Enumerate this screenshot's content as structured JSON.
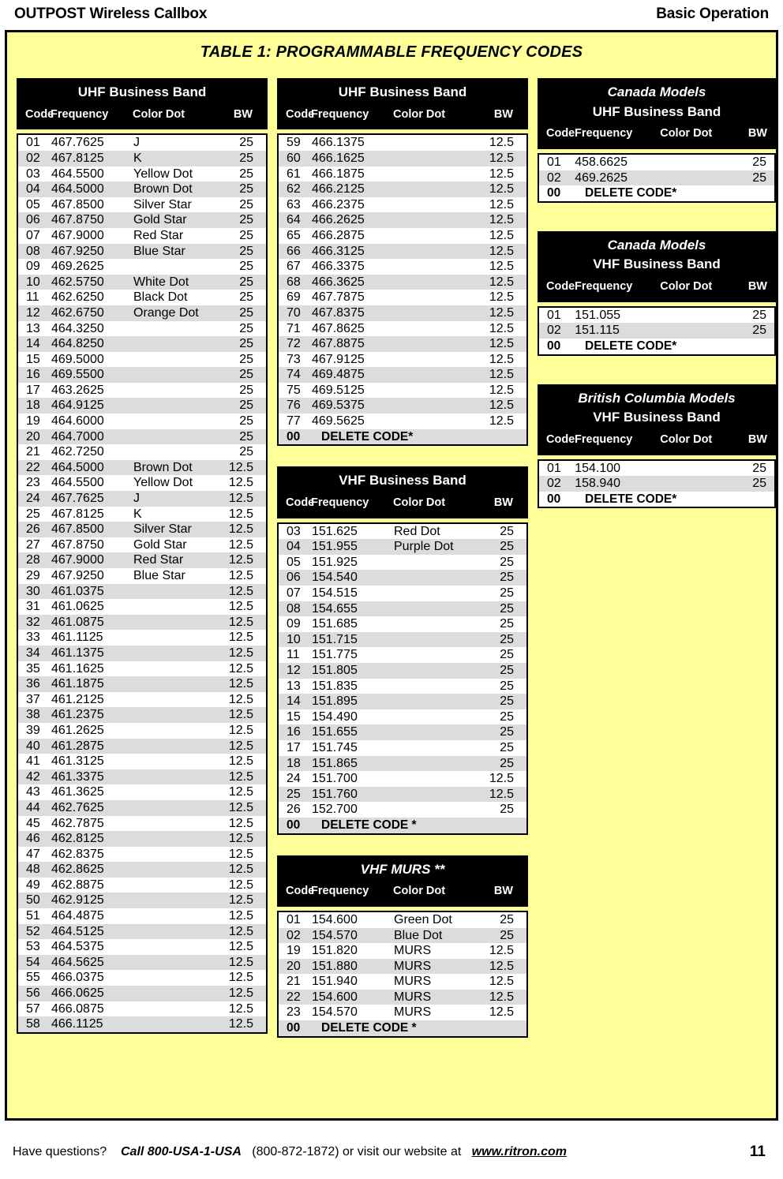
{
  "colors": {
    "panel_background": "#ffff99",
    "header_background": "#000000",
    "header_text": "#ffffff",
    "row_shade": "#dcdcdc",
    "page_background": "#ffffff"
  },
  "running_head": {
    "left": "OUTPOST Wireless Callbox",
    "right": "Basic Operation"
  },
  "panel": {
    "title": "TABLE 1: PROGRAMMABLE FREQUENCY CODES"
  },
  "column_headers": {
    "code": "Code",
    "frequency": "Frequency",
    "color_dot": "Color Dot",
    "bw": "BW"
  },
  "tables": [
    {
      "id": "uhf-business-band-1",
      "column": 1,
      "title_lines": [
        "UHF Business Band"
      ],
      "italic_first_line": false,
      "rows": [
        {
          "code": "01",
          "frequency": "467.7625",
          "color_dot": "J",
          "bw": "25",
          "shade": false
        },
        {
          "code": "02",
          "frequency": "467.8125",
          "color_dot": "K",
          "bw": "25",
          "shade": true
        },
        {
          "code": "03",
          "frequency": "464.5500",
          "color_dot": "Yellow Dot",
          "bw": "25",
          "shade": false
        },
        {
          "code": "04",
          "frequency": "464.5000",
          "color_dot": "Brown Dot",
          "bw": "25",
          "shade": true
        },
        {
          "code": "05",
          "frequency": "467.8500",
          "color_dot": "Silver Star",
          "bw": "25",
          "shade": false
        },
        {
          "code": "06",
          "frequency": "467.8750",
          "color_dot": "Gold Star",
          "bw": "25",
          "shade": true
        },
        {
          "code": "07",
          "frequency": "467.9000",
          "color_dot": "Red Star",
          "bw": "25",
          "shade": false
        },
        {
          "code": "08",
          "frequency": "467.9250",
          "color_dot": "Blue Star",
          "bw": "25",
          "shade": true
        },
        {
          "code": "09",
          "frequency": "469.2625",
          "color_dot": "",
          "bw": "25",
          "shade": false
        },
        {
          "code": "10",
          "frequency": "462.5750",
          "color_dot": "White Dot",
          "bw": "25",
          "shade": true
        },
        {
          "code": "11",
          "frequency": "462.6250",
          "color_dot": "Black Dot",
          "bw": "25",
          "shade": false
        },
        {
          "code": "12",
          "frequency": "462.6750",
          "color_dot": "Orange Dot",
          "bw": "25",
          "shade": true
        },
        {
          "code": "13",
          "frequency": "464.3250",
          "color_dot": "",
          "bw": "25",
          "shade": false
        },
        {
          "code": "14",
          "frequency": "464.8250",
          "color_dot": "",
          "bw": "25",
          "shade": true
        },
        {
          "code": "15",
          "frequency": "469.5000",
          "color_dot": "",
          "bw": "25",
          "shade": false
        },
        {
          "code": "16",
          "frequency": "469.5500",
          "color_dot": "",
          "bw": "25",
          "shade": true
        },
        {
          "code": "17",
          "frequency": "463.2625",
          "color_dot": "",
          "bw": "25",
          "shade": false
        },
        {
          "code": "18",
          "frequency": "464.9125",
          "color_dot": "",
          "bw": "25",
          "shade": true
        },
        {
          "code": "19",
          "frequency": "464.6000",
          "color_dot": "",
          "bw": "25",
          "shade": false
        },
        {
          "code": "20",
          "frequency": "464.7000",
          "color_dot": "",
          "bw": "25",
          "shade": true
        },
        {
          "code": "21",
          "frequency": "462.7250",
          "color_dot": "",
          "bw": "25",
          "shade": false
        },
        {
          "code": "22",
          "frequency": "464.5000",
          "color_dot": "Brown Dot",
          "bw": "12.5",
          "shade": true
        },
        {
          "code": "23",
          "frequency": "464.5500",
          "color_dot": "Yellow Dot",
          "bw": "12.5",
          "shade": false
        },
        {
          "code": "24",
          "frequency": "467.7625",
          "color_dot": "J",
          "bw": "12.5",
          "shade": true
        },
        {
          "code": "25",
          "frequency": "467.8125",
          "color_dot": "K",
          "bw": "12.5",
          "shade": false
        },
        {
          "code": "26",
          "frequency": "467.8500",
          "color_dot": "Silver Star",
          "bw": "12.5",
          "shade": true
        },
        {
          "code": "27",
          "frequency": "467.8750",
          "color_dot": "Gold Star",
          "bw": "12.5",
          "shade": false
        },
        {
          "code": "28",
          "frequency": "467.9000",
          "color_dot": "Red Star",
          "bw": "12.5",
          "shade": true
        },
        {
          "code": "29",
          "frequency": "467.9250",
          "color_dot": "Blue Star",
          "bw": "12.5",
          "shade": false
        },
        {
          "code": "30",
          "frequency": "461.0375",
          "color_dot": "",
          "bw": "12.5",
          "shade": true
        },
        {
          "code": "31",
          "frequency": "461.0625",
          "color_dot": "",
          "bw": "12.5",
          "shade": false
        },
        {
          "code": "32",
          "frequency": "461.0875",
          "color_dot": "",
          "bw": "12.5",
          "shade": true
        },
        {
          "code": "33",
          "frequency": "461.1125",
          "color_dot": "",
          "bw": "12.5",
          "shade": false
        },
        {
          "code": "34",
          "frequency": "461.1375",
          "color_dot": "",
          "bw": "12.5",
          "shade": true
        },
        {
          "code": "35",
          "frequency": "461.1625",
          "color_dot": "",
          "bw": "12.5",
          "shade": false
        },
        {
          "code": "36",
          "frequency": "461.1875",
          "color_dot": "",
          "bw": "12.5",
          "shade": true
        },
        {
          "code": "37",
          "frequency": "461.2125",
          "color_dot": "",
          "bw": "12.5",
          "shade": false
        },
        {
          "code": "38",
          "frequency": "461.2375",
          "color_dot": "",
          "bw": "12.5",
          "shade": true
        },
        {
          "code": "39",
          "frequency": "461.2625",
          "color_dot": "",
          "bw": "12.5",
          "shade": false
        },
        {
          "code": "40",
          "frequency": "461.2875",
          "color_dot": "",
          "bw": "12.5",
          "shade": true
        },
        {
          "code": "41",
          "frequency": "461.3125",
          "color_dot": "",
          "bw": "12.5",
          "shade": false
        },
        {
          "code": "42",
          "frequency": "461.3375",
          "color_dot": "",
          "bw": "12.5",
          "shade": true
        },
        {
          "code": "43",
          "frequency": "461.3625",
          "color_dot": "",
          "bw": "12.5",
          "shade": false
        },
        {
          "code": "44",
          "frequency": "462.7625",
          "color_dot": "",
          "bw": "12.5",
          "shade": true
        },
        {
          "code": "45",
          "frequency": "462.7875",
          "color_dot": "",
          "bw": "12.5",
          "shade": false
        },
        {
          "code": "46",
          "frequency": "462.8125",
          "color_dot": "",
          "bw": "12.5",
          "shade": true
        },
        {
          "code": "47",
          "frequency": "462.8375",
          "color_dot": "",
          "bw": "12.5",
          "shade": false
        },
        {
          "code": "48",
          "frequency": "462.8625",
          "color_dot": "",
          "bw": "12.5",
          "shade": true
        },
        {
          "code": "49",
          "frequency": "462.8875",
          "color_dot": "",
          "bw": "12.5",
          "shade": false
        },
        {
          "code": "50",
          "frequency": "462.9125",
          "color_dot": "",
          "bw": "12.5",
          "shade": true
        },
        {
          "code": "51",
          "frequency": "464.4875",
          "color_dot": "",
          "bw": "12.5",
          "shade": false
        },
        {
          "code": "52",
          "frequency": "464.5125",
          "color_dot": "",
          "bw": "12.5",
          "shade": true
        },
        {
          "code": "53",
          "frequency": "464.5375",
          "color_dot": "",
          "bw": "12.5",
          "shade": false
        },
        {
          "code": "54",
          "frequency": "464.5625",
          "color_dot": "",
          "bw": "12.5",
          "shade": true
        },
        {
          "code": "55",
          "frequency": "466.0375",
          "color_dot": "",
          "bw": "12.5",
          "shade": false
        },
        {
          "code": "56",
          "frequency": "466.0625",
          "color_dot": "",
          "bw": "12.5",
          "shade": true
        },
        {
          "code": "57",
          "frequency": "466.0875",
          "color_dot": "",
          "bw": "12.5",
          "shade": false
        },
        {
          "code": "58",
          "frequency": "466.1125",
          "color_dot": "",
          "bw": "12.5",
          "shade": true
        }
      ]
    },
    {
      "id": "uhf-business-band-2",
      "column": 2,
      "title_lines": [
        "UHF Business Band"
      ],
      "italic_first_line": false,
      "rows": [
        {
          "code": "59",
          "frequency": "466.1375",
          "color_dot": "",
          "bw": "12.5",
          "shade": false
        },
        {
          "code": "60",
          "frequency": "466.1625",
          "color_dot": "",
          "bw": "12.5",
          "shade": true
        },
        {
          "code": "61",
          "frequency": "466.1875",
          "color_dot": "",
          "bw": "12.5",
          "shade": false
        },
        {
          "code": "62",
          "frequency": "466.2125",
          "color_dot": "",
          "bw": "12.5",
          "shade": true
        },
        {
          "code": "63",
          "frequency": "466.2375",
          "color_dot": "",
          "bw": "12.5",
          "shade": false
        },
        {
          "code": "64",
          "frequency": "466.2625",
          "color_dot": "",
          "bw": "12.5",
          "shade": true
        },
        {
          "code": "65",
          "frequency": "466.2875",
          "color_dot": "",
          "bw": "12.5",
          "shade": false
        },
        {
          "code": "66",
          "frequency": "466.3125",
          "color_dot": "",
          "bw": "12.5",
          "shade": true
        },
        {
          "code": "67",
          "frequency": "466.3375",
          "color_dot": "",
          "bw": "12.5",
          "shade": false
        },
        {
          "code": "68",
          "frequency": "466.3625",
          "color_dot": "",
          "bw": "12.5",
          "shade": true
        },
        {
          "code": "69",
          "frequency": "467.7875",
          "color_dot": "",
          "bw": "12.5",
          "shade": false
        },
        {
          "code": "70",
          "frequency": "467.8375",
          "color_dot": "",
          "bw": "12.5",
          "shade": true
        },
        {
          "code": "71",
          "frequency": "467.8625",
          "color_dot": "",
          "bw": "12.5",
          "shade": false
        },
        {
          "code": "72",
          "frequency": "467.8875",
          "color_dot": "",
          "bw": "12.5",
          "shade": true
        },
        {
          "code": "73",
          "frequency": "467.9125",
          "color_dot": "",
          "bw": "12.5",
          "shade": false
        },
        {
          "code": "74",
          "frequency": "469.4875",
          "color_dot": "",
          "bw": "12.5",
          "shade": true
        },
        {
          "code": "75",
          "frequency": "469.5125",
          "color_dot": "",
          "bw": "12.5",
          "shade": false
        },
        {
          "code": "76",
          "frequency": "469.5375",
          "color_dot": "",
          "bw": "12.5",
          "shade": true
        },
        {
          "code": "77",
          "frequency": "469.5625",
          "color_dot": "",
          "bw": "12.5",
          "shade": false
        },
        {
          "code": "00",
          "delete_label": "DELETE CODE*",
          "shade": true,
          "is_delete": true
        }
      ]
    },
    {
      "id": "vhf-business-band",
      "column": 2,
      "title_lines": [
        "VHF Business Band"
      ],
      "italic_first_line": false,
      "rows": [
        {
          "code": "03",
          "frequency": "151.625",
          "color_dot": "Red Dot",
          "bw": "25",
          "shade": false
        },
        {
          "code": "04",
          "frequency": "151.955",
          "color_dot": "Purple Dot",
          "bw": "25",
          "shade": true
        },
        {
          "code": "05",
          "frequency": "151.925",
          "color_dot": "",
          "bw": "25",
          "shade": false
        },
        {
          "code": "06",
          "frequency": "154.540",
          "color_dot": "",
          "bw": "25",
          "shade": true
        },
        {
          "code": "07",
          "frequency": "154.515",
          "color_dot": "",
          "bw": "25",
          "shade": false
        },
        {
          "code": "08",
          "frequency": "154.655",
          "color_dot": "",
          "bw": "25",
          "shade": true
        },
        {
          "code": "09",
          "frequency": "151.685",
          "color_dot": "",
          "bw": "25",
          "shade": false
        },
        {
          "code": "10",
          "frequency": "151.715",
          "color_dot": "",
          "bw": "25",
          "shade": true
        },
        {
          "code": "11",
          "frequency": "151.775",
          "color_dot": "",
          "bw": "25",
          "shade": false
        },
        {
          "code": "12",
          "frequency": "151.805",
          "color_dot": "",
          "bw": "25",
          "shade": true
        },
        {
          "code": "13",
          "frequency": "151.835",
          "color_dot": "",
          "bw": "25",
          "shade": false
        },
        {
          "code": "14",
          "frequency": "151.895",
          "color_dot": "",
          "bw": "25",
          "shade": true
        },
        {
          "code": "15",
          "frequency": "154.490",
          "color_dot": "",
          "bw": "25",
          "shade": false
        },
        {
          "code": "16",
          "frequency": "151.655",
          "color_dot": "",
          "bw": "25",
          "shade": true
        },
        {
          "code": "17",
          "frequency": "151.745",
          "color_dot": "",
          "bw": "25",
          "shade": false
        },
        {
          "code": "18",
          "frequency": "151.865",
          "color_dot": "",
          "bw": "25",
          "shade": true
        },
        {
          "code": "24",
          "frequency": "151.700",
          "color_dot": "",
          "bw": "12.5",
          "shade": false
        },
        {
          "code": "25",
          "frequency": "151.760",
          "color_dot": "",
          "bw": "12.5",
          "shade": true
        },
        {
          "code": "26",
          "frequency": "152.700",
          "color_dot": "",
          "bw": "25",
          "shade": false
        },
        {
          "code": "00",
          "delete_label": "DELETE CODE *",
          "shade": true,
          "is_delete": true
        }
      ]
    },
    {
      "id": "vhf-murs",
      "column": 2,
      "title_lines": [
        "VHF MURS **"
      ],
      "italic_first_line": true,
      "rows": [
        {
          "code": "01",
          "frequency": "154.600",
          "color_dot": "Green Dot",
          "bw": "25",
          "shade": false
        },
        {
          "code": "02",
          "frequency": "154.570",
          "color_dot": "Blue Dot",
          "bw": "25",
          "shade": true
        },
        {
          "code": "19",
          "frequency": "151.820",
          "color_dot": "MURS",
          "bw": "12.5",
          "shade": false
        },
        {
          "code": "20",
          "frequency": "151.880",
          "color_dot": "MURS",
          "bw": "12.5",
          "shade": true
        },
        {
          "code": "21",
          "frequency": "151.940",
          "color_dot": "MURS",
          "bw": "12.5",
          "shade": false
        },
        {
          "code": "22",
          "frequency": "154.600",
          "color_dot": "MURS",
          "bw": "12.5",
          "shade": true
        },
        {
          "code": "23",
          "frequency": "154.570",
          "color_dot": "MURS",
          "bw": "12.5",
          "shade": false
        },
        {
          "code": "00",
          "delete_label": "DELETE CODE *",
          "shade": true,
          "is_delete": true
        }
      ]
    },
    {
      "id": "canada-uhf",
      "column": 3,
      "title_lines": [
        "Canada Models",
        "UHF Business Band"
      ],
      "italic_first_line": true,
      "rows": [
        {
          "code": "01",
          "frequency": "458.6625",
          "color_dot": "",
          "bw": "25",
          "shade": false
        },
        {
          "code": "02",
          "frequency": "469.2625",
          "color_dot": "",
          "bw": "25",
          "shade": true
        },
        {
          "code": "00",
          "delete_label": "DELETE CODE*",
          "shade": false,
          "is_delete": true
        }
      ]
    },
    {
      "id": "canada-vhf",
      "column": 3,
      "title_lines": [
        "Canada Models",
        "VHF Business Band"
      ],
      "italic_first_line": true,
      "rows": [
        {
          "code": "01",
          "frequency": "151.055",
          "color_dot": "",
          "bw": "25",
          "shade": false
        },
        {
          "code": "02",
          "frequency": "151.115",
          "color_dot": "",
          "bw": "25",
          "shade": true
        },
        {
          "code": "00",
          "delete_label": "DELETE CODE*",
          "shade": false,
          "is_delete": true
        }
      ]
    },
    {
      "id": "british-columbia-vhf",
      "column": 3,
      "title_lines": [
        "British Columbia  Models",
        "VHF Business Band"
      ],
      "italic_first_line": true,
      "rows": [
        {
          "code": "01",
          "frequency": "154.100",
          "color_dot": "",
          "bw": "25",
          "shade": false
        },
        {
          "code": "02",
          "frequency": "158.940",
          "color_dot": "",
          "bw": "25",
          "shade": true
        },
        {
          "code": "00",
          "delete_label": "DELETE CODE*",
          "shade": false,
          "is_delete": true
        }
      ]
    }
  ],
  "footer": {
    "lead": "Have questions?",
    "call": "Call 800-USA-1-USA",
    "middle": "(800-872-1872) or visit our website at",
    "url": "www.ritron.com",
    "page_number": "11"
  }
}
